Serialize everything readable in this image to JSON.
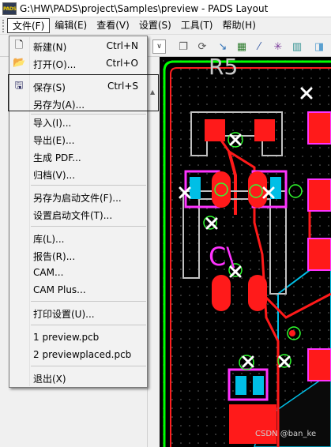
{
  "window": {
    "app_icon_text": "PADS",
    "title": "G:\\HW\\PADS\\project\\Samples\\preview - PADS Layout"
  },
  "menubar": {
    "items": [
      {
        "label": "文件(F)",
        "active": true
      },
      {
        "label": "编辑(E)"
      },
      {
        "label": "查看(V)"
      },
      {
        "label": "设置(S)"
      },
      {
        "label": "工具(T)"
      },
      {
        "label": "帮助(H)"
      }
    ]
  },
  "file_menu": {
    "items": [
      {
        "label": "新建(N)",
        "shortcut": "Ctrl+N",
        "icon": "new-file-icon"
      },
      {
        "label": "打开(O)...",
        "shortcut": "Ctrl+O",
        "icon": "open-folder-icon"
      },
      {
        "label": "保存(S)",
        "shortcut": "Ctrl+S",
        "icon": "save-disk-icon"
      },
      {
        "label": "另存为(A)..."
      },
      {
        "label": "导入(I)..."
      },
      {
        "label": "导出(E)..."
      },
      {
        "label": "生成 PDF..."
      },
      {
        "label": "归档(V)..."
      },
      {
        "label": "另存为启动文件(F)..."
      },
      {
        "label": "设置启动文件(T)..."
      },
      {
        "label": "库(L)..."
      },
      {
        "label": "报告(R)..."
      },
      {
        "label": "CAM..."
      },
      {
        "label": "CAM Plus..."
      },
      {
        "label": "打印设置(U)..."
      },
      {
        "label": "1 preview.pcb"
      },
      {
        "label": "2 previewplaced.pcb"
      },
      {
        "label": "退出(X)"
      }
    ]
  },
  "pcb": {
    "ref_designators": [
      "R5",
      "C\\"
    ],
    "background": "#000000",
    "pad_color": "#ff1a1a",
    "outline_color": "#c0c0c0",
    "board_edge_color": "#00ff00",
    "copper_pour_color": "#00bfe6",
    "silk_magenta": "#ff33ff"
  },
  "watermark": {
    "text": "CSDN @ban_ke"
  }
}
